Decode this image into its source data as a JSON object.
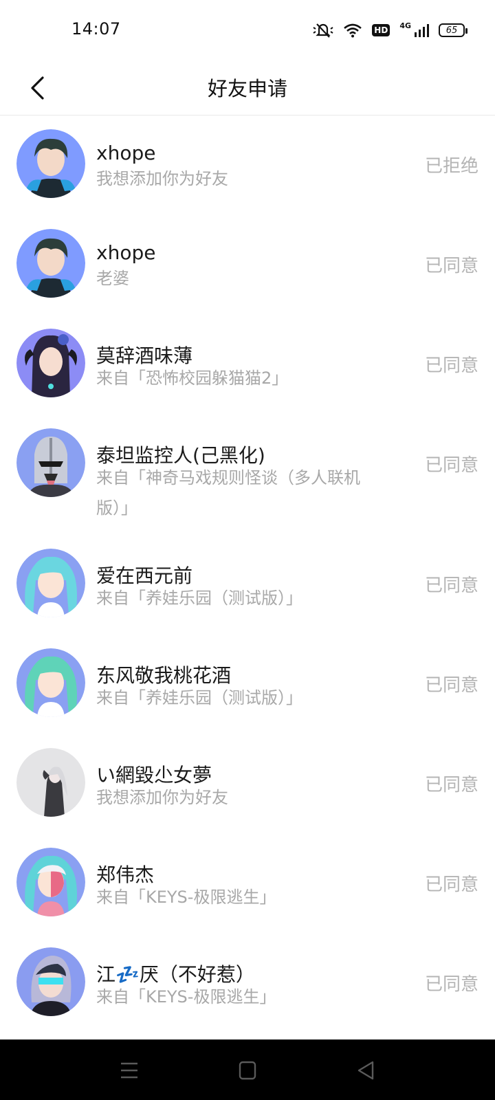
{
  "status_bar": {
    "time": "14:07",
    "hd_label": "HD",
    "network_label": "4G",
    "battery_level": "65",
    "icons": [
      "mute-icon",
      "wifi-icon",
      "hd-icon",
      "signal-icon",
      "battery-icon"
    ]
  },
  "header": {
    "title": "好友申请",
    "back_icon": "chevron-left-icon"
  },
  "requests": [
    {
      "name": "xhope",
      "message": "我想添加你为好友",
      "status": "已拒绝",
      "avatar_colors": [
        "#7f9bff",
        "#2c3e3a"
      ]
    },
    {
      "name": "xhope",
      "message": "老婆",
      "status": "已同意",
      "avatar_colors": [
        "#7f9bff",
        "#2c3e3a"
      ]
    },
    {
      "name": "莫辞酒味薄",
      "message": "来自「恐怖校园躲猫猫2」",
      "status": "已同意",
      "avatar_colors": [
        "#8c8cf5",
        "#2a2540"
      ]
    },
    {
      "name": "泰坦监控人(己黑化)",
      "message": "来自「神奇马戏规则怪谈（多人联机版）」",
      "status": "已同意",
      "avatar_colors": [
        "#8aa0f2",
        "#c8ccd8"
      ]
    },
    {
      "name": "爱在西元前",
      "message": "来自「养娃乐园（测试版）」",
      "status": "已同意",
      "avatar_colors": [
        "#8aa0f2",
        "#6ad6e0"
      ]
    },
    {
      "name": "东风敬我桃花酒",
      "message": "来自「养娃乐园（测试版）」",
      "status": "已同意",
      "avatar_colors": [
        "#8aa0f2",
        "#5fd3b8"
      ]
    },
    {
      "name": "い網毀尐女夢",
      "message": "我想添加你为好友",
      "status": "已同意",
      "avatar_colors": [
        "#e4e4e6",
        "#3a3a3f"
      ]
    },
    {
      "name": "郑伟杰",
      "message": "来自「KEYS-极限逃生」",
      "status": "已同意",
      "avatar_colors": [
        "#8aa0f2",
        "#5fd3d8"
      ]
    },
    {
      "name": "江💤厌（不好惹）",
      "message": "来自「KEYS-极限逃生」",
      "status": "已同意",
      "avatar_colors": [
        "#8a9cf0",
        "#2d3446"
      ]
    }
  ],
  "nav_bar": {
    "buttons": [
      "menu-icon",
      "home-icon",
      "back-triangle-icon"
    ]
  }
}
